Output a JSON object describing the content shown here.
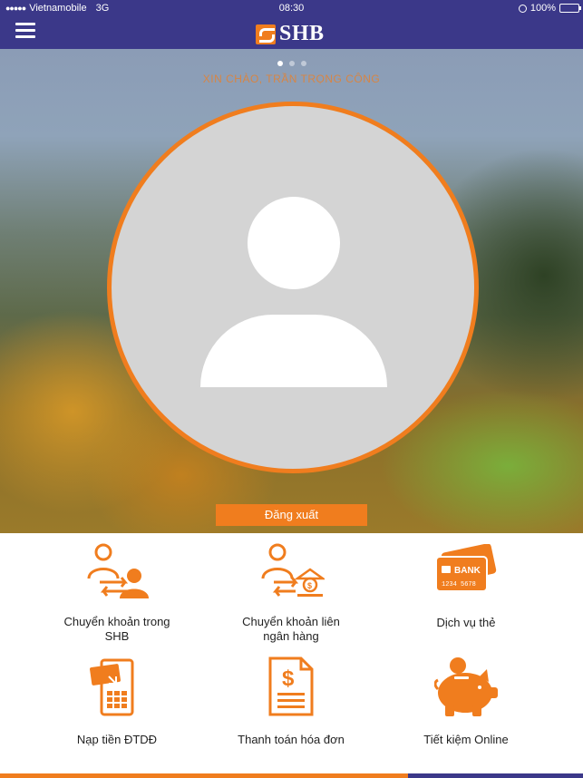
{
  "status_bar": {
    "carrier": "Vietnamobile",
    "network": "3G",
    "time": "08:30",
    "battery": "100%"
  },
  "header": {
    "brand": "SHB",
    "menu_icon": "hamburger-icon"
  },
  "hero": {
    "greeting": "XIN CHÀO, TRẦN TRỌNG CÔNG",
    "page_count": 3,
    "active_page": 1,
    "logout_label": "Đăng xuất"
  },
  "services": [
    {
      "label": "Chuyển khoản trong SHB",
      "label_lines": [
        "Chuyển khoản trong",
        "SHB"
      ],
      "icon": "transfer-internal-icon"
    },
    {
      "label": "Chuyển khoản liên ngân hàng",
      "label_lines": [
        "Chuyển khoản liên",
        "ngân hàng"
      ],
      "icon": "transfer-interbank-icon"
    },
    {
      "label": "Dịch vụ thẻ",
      "label_lines": [
        "Dịch vụ thẻ"
      ],
      "icon": "bank-card-icon",
      "card_text": "BANK",
      "card_number": "1234 5678"
    },
    {
      "label": "Nạp tiền ĐTDĐ",
      "label_lines": [
        "Nạp tiền ĐTDĐ"
      ],
      "icon": "mobile-topup-icon"
    },
    {
      "label": "Thanh toán hóa đơn",
      "label_lines": [
        "Thanh toán hóa đơn"
      ],
      "icon": "bill-payment-icon"
    },
    {
      "label": "Tiết kiệm Online",
      "label_lines": [
        "Tiết kiệm Online"
      ],
      "icon": "piggy-bank-icon"
    }
  ],
  "colors": {
    "header": "#3b3889",
    "accent": "#f07d1e",
    "battery": "#4cd964"
  }
}
